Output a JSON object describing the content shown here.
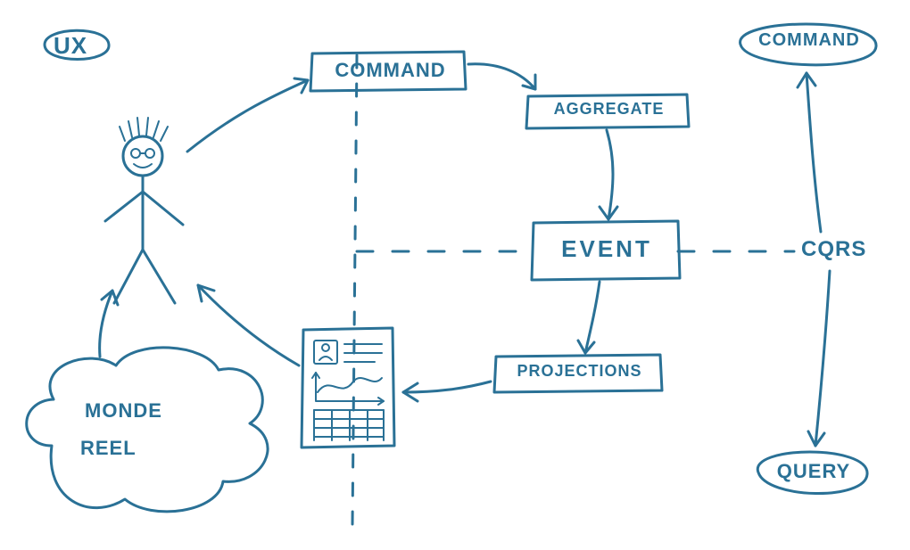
{
  "badge": {
    "ux": "UX"
  },
  "nodes": {
    "command": "COMMAND",
    "aggregate": "AGGREGATE",
    "event": "EVENT",
    "projections": "PROJECTIONS"
  },
  "cloud": {
    "line1": "MONDE",
    "line2": "REEL"
  },
  "right": {
    "cqrs": "CQRS",
    "command": "COMMAND",
    "query": "QUERY"
  }
}
